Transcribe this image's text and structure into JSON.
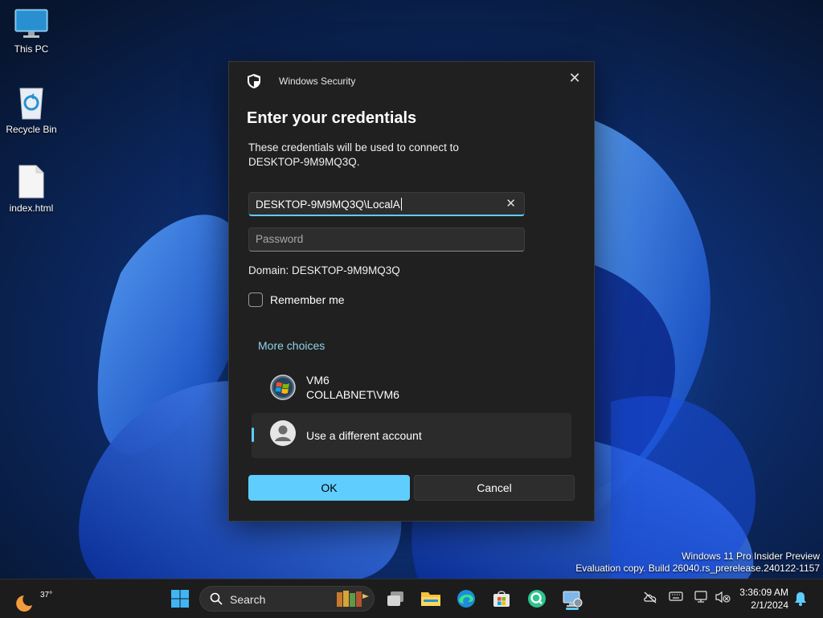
{
  "desktop": {
    "icons": [
      {
        "label": "This PC",
        "icon": "monitor-icon"
      },
      {
        "label": "Recycle Bin",
        "icon": "recycle-bin-icon"
      },
      {
        "label": "index.html",
        "icon": "file-icon"
      }
    ]
  },
  "dialog": {
    "window_title": "Windows Security",
    "heading": "Enter your credentials",
    "description": "These credentials will be used to connect to DESKTOP-9M9MQ3Q.",
    "username_value": "DESKTOP-9M9MQ3Q\\LocalA",
    "password_placeholder": "Password",
    "domain_text": "Domain: DESKTOP-9M9MQ3Q",
    "remember_label": "Remember me",
    "remember_checked": false,
    "more_choices_label": "More choices",
    "accounts": [
      {
        "name": "VM6",
        "detail": "COLLABNET\\VM6",
        "icon": "windows-logo-avatar-icon"
      },
      {
        "name": "Use a different account",
        "icon": "person-avatar-icon",
        "selected": true
      }
    ],
    "ok_label": "OK",
    "cancel_label": "Cancel",
    "accent_color": "#60cdff"
  },
  "watermark": {
    "line1": "Windows 11 Pro Insider Preview",
    "line2": "Evaluation copy. Build 26040.rs_prerelease.240122-1157"
  },
  "taskbar": {
    "weather_temp": "37°",
    "search_label": "Search",
    "pinned": [
      "start-icon",
      "task-view-icon",
      "file-explorer-icon",
      "edge-icon",
      "store-icon",
      "app-icon",
      "remote-desktop-icon"
    ],
    "clock_time": "3:36:09 AM",
    "clock_date": "2/1/2024"
  }
}
